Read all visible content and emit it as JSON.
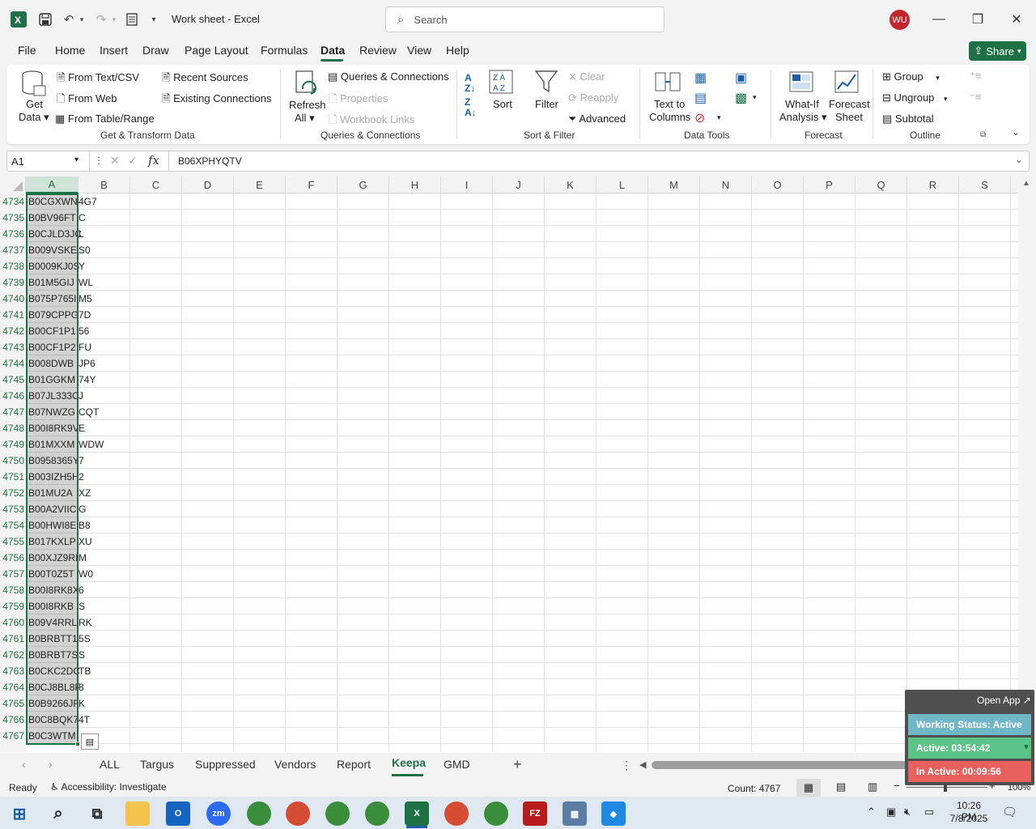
{
  "title_bar": {
    "doc_title": "Work sheet  -  Excel",
    "search_placeholder": "Search",
    "avatar_initials": "WU"
  },
  "menu": {
    "items": [
      "File",
      "Home",
      "Insert",
      "Draw",
      "Page Layout",
      "Formulas",
      "Data",
      "Review",
      "Help"
    ],
    "active": "Data",
    "share_label": "Share"
  },
  "ribbon": {
    "get_data": {
      "line1": "Get",
      "line2": "Data"
    },
    "from_text_csv": "From Text/CSV",
    "from_web": "From Web",
    "from_table_range": "From Table/Range",
    "recent_sources": "Recent Sources",
    "existing_connections": "Existing Connections",
    "group_get_transform": "Get & Transform Data",
    "refresh_all": {
      "line1": "Refresh",
      "line2": "All"
    },
    "queries_connections": "Queries & Connections",
    "properties": "Properties",
    "workbook_links": "Workbook Links",
    "group_queries": "Queries & Connections",
    "sort": "Sort",
    "filter": "Filter",
    "clear": "Clear",
    "reapply": "Reapply",
    "advanced": "Advanced",
    "group_sort_filter": "Sort & Filter",
    "text_to_columns": {
      "line1": "Text to",
      "line2": "Columns"
    },
    "group_data_tools": "Data Tools",
    "what_if": {
      "line1": "What-If",
      "line2": "Analysis"
    },
    "forecast_sheet": {
      "line1": "Forecast",
      "line2": "Sheet"
    },
    "group_forecast": "Forecast",
    "group": "Group",
    "ungroup": "Ungroup",
    "subtotal": "Subtotal",
    "group_outline": "Outline"
  },
  "formula_bar": {
    "name_box": "A1",
    "fx": "fx",
    "formula": "B06XPHYQTV"
  },
  "columns": [
    "A",
    "B",
    "C",
    "D",
    "E",
    "F",
    "G",
    "H",
    "I",
    "J",
    "K",
    "L",
    "M",
    "N",
    "O",
    "P",
    "Q",
    "R",
    "S"
  ],
  "rows": [
    {
      "n": "4734",
      "a": "B0CGXWN",
      "b": "4G7"
    },
    {
      "n": "4735",
      "a": "B0BV96FT",
      "b": "C"
    },
    {
      "n": "4736",
      "a": "B0CJLD3JC",
      "b": "L"
    },
    {
      "n": "4737",
      "a": "B009VSKE",
      "b": "S0"
    },
    {
      "n": "4738",
      "a": "B0009KJ0S",
      "b": "Y"
    },
    {
      "n": "4739",
      "a": "B01M5GIJ",
      "b": "WL"
    },
    {
      "n": "4740",
      "a": "B075P765I",
      "b": "M5"
    },
    {
      "n": "4741",
      "a": "B079CPPG",
      "b": "7D"
    },
    {
      "n": "4742",
      "a": "B00CF1P1",
      "b": "56"
    },
    {
      "n": "4743",
      "a": "B00CF1P2",
      "b": "FU"
    },
    {
      "n": "4744",
      "a": "B008DWB",
      "b": "JP6"
    },
    {
      "n": "4745",
      "a": "B01GGKM",
      "b": "74Y"
    },
    {
      "n": "4746",
      "a": "B07JL333C",
      "b": "J"
    },
    {
      "n": "4747",
      "a": "B07NWZG",
      "b": "CQT"
    },
    {
      "n": "4748",
      "a": "B00I8RK9V",
      "b": "E"
    },
    {
      "n": "4749",
      "a": "B01MXXM",
      "b": "WDW"
    },
    {
      "n": "4750",
      "a": "B0958365Y",
      "b": "7"
    },
    {
      "n": "4751",
      "a": "B003IZH5H",
      "b": "2"
    },
    {
      "n": "4752",
      "a": "B01MU2A",
      "b": "XZ"
    },
    {
      "n": "4753",
      "a": "B00A2VIIC",
      "b": "G"
    },
    {
      "n": "4754",
      "a": "B00HWI8E",
      "b": "B8"
    },
    {
      "n": "4755",
      "a": "B017KXLP",
      "b": "XU"
    },
    {
      "n": "4756",
      "a": "B00XJZ9RI",
      "b": "M"
    },
    {
      "n": "4757",
      "a": "B00T0Z5T",
      "b": "W0"
    },
    {
      "n": "4758",
      "a": "B00I8RK8X",
      "b": "6"
    },
    {
      "n": "4759",
      "a": "B00I8RKB",
      "b": "S"
    },
    {
      "n": "4760",
      "a": "B09V4RRL",
      "b": "RK"
    },
    {
      "n": "4761",
      "a": "B0BRBTT1",
      "b": "5S"
    },
    {
      "n": "4762",
      "a": "B0BRBT7S",
      "b": "S"
    },
    {
      "n": "4763",
      "a": "B0CKC2DC",
      "b": "TB"
    },
    {
      "n": "4764",
      "a": "B0CJ8BL8F",
      "b": "8"
    },
    {
      "n": "4765",
      "a": "B0B9266JF",
      "b": "K"
    },
    {
      "n": "4766",
      "a": "B0C8BQK7",
      "b": "4T"
    },
    {
      "n": "4767",
      "a": "B0C3WTM",
      "b": ""
    }
  ],
  "sheet_tabs": [
    "ALL",
    "Targus",
    "Suppressed",
    "Vendors",
    "Report",
    "Keepa",
    "GMD"
  ],
  "active_sheet": "Keepa",
  "status": {
    "ready": "Ready",
    "accessibility": "Accessibility: Investigate",
    "count": "Count: 4767",
    "zoom": "100%"
  },
  "widget": {
    "open_app": "Open App",
    "working_status": "Working Status: Active",
    "active": "Active: 03:54:42",
    "inactive": "In Active: 00:09:56"
  },
  "taskbar": {
    "time": "10:26 PM",
    "date": "7/8/2025"
  },
  "colors": {
    "excel_green": "#1e7145",
    "active_green": "#5cc486",
    "inactive_red": "#e9615f",
    "status_teal": "#6fb7c7"
  }
}
